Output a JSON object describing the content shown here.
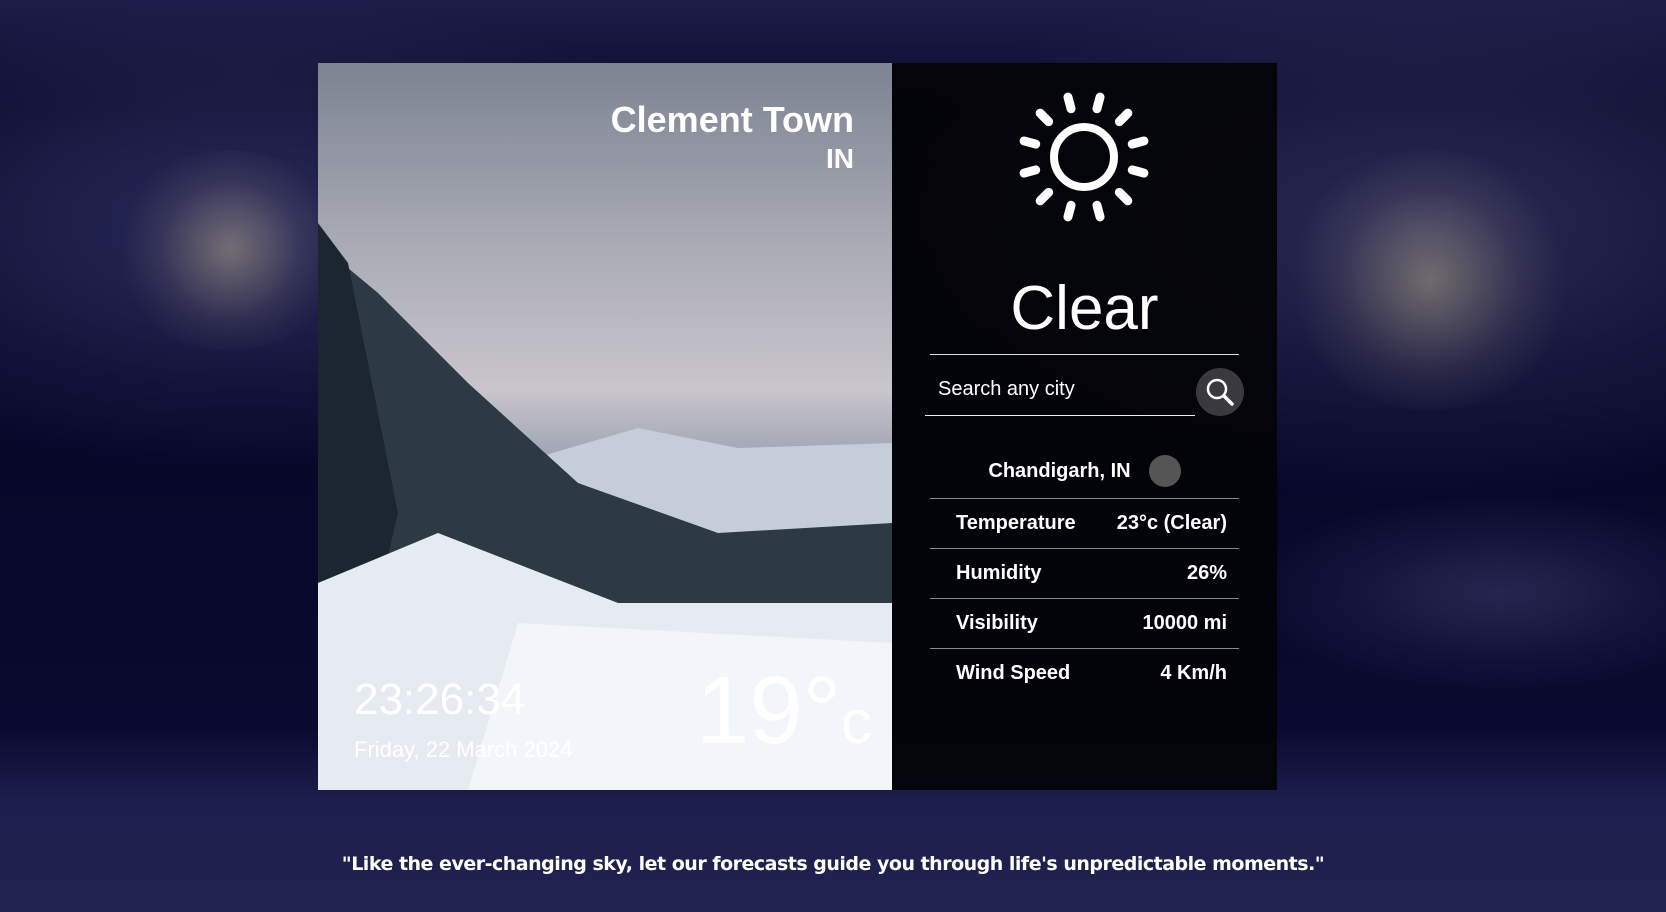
{
  "location": {
    "city": "Clement Town",
    "country": "IN"
  },
  "clock": {
    "time": "23:26:34",
    "date": "Friday, 22 March 2024"
  },
  "current": {
    "temp": "19°",
    "unit": "c"
  },
  "panel": {
    "condition": "Clear",
    "icon": "sun-icon",
    "search": {
      "placeholder": "Search any city",
      "value": ""
    },
    "selected_location": "Chandigarh, IN",
    "details": [
      {
        "label": "Temperature",
        "value": "23°c (Clear)"
      },
      {
        "label": "Humidity",
        "value": "26%"
      },
      {
        "label": "Visibility",
        "value": "10000 mi"
      },
      {
        "label": "Wind Speed",
        "value": "4 Km/h"
      }
    ]
  },
  "quote": "\"Like the ever-changing sky, let our forecasts guide you through life's unpredictable moments.\""
}
